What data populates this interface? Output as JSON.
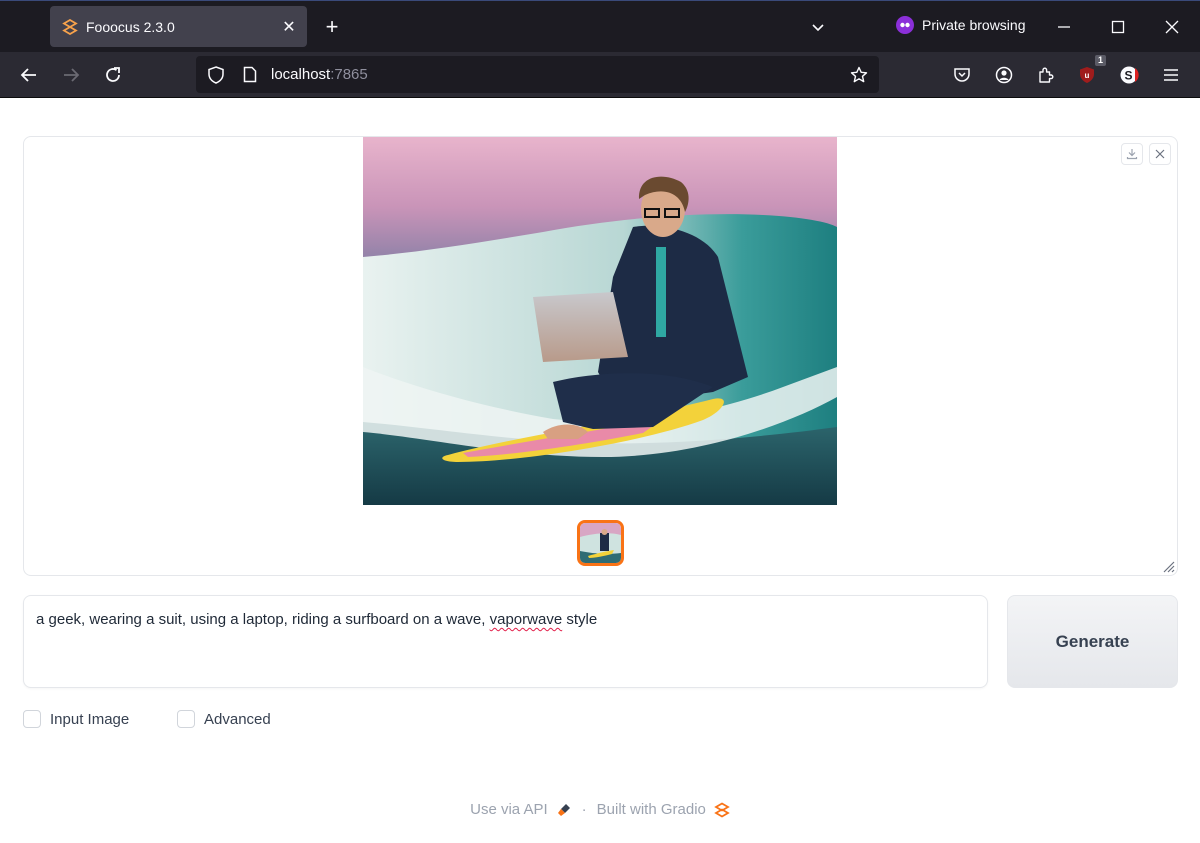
{
  "browser": {
    "tab": {
      "title": "Fooocus 2.3.0",
      "favicon": "gradio-logo-icon"
    },
    "private_label": "Private browsing",
    "url": {
      "host": "localhost",
      "port": ":7865"
    },
    "extension_badge": "1",
    "icons": {
      "back": "arrow-left-icon",
      "forward": "arrow-right-icon",
      "reload": "reload-icon",
      "shield": "tracking-protection-icon",
      "page": "page-icon",
      "bookmark": "star-icon",
      "pocket": "pocket-icon",
      "account": "account-icon",
      "extensions": "puzzle-icon",
      "ublock": "ublock-icon",
      "extension2": "s-extension-icon",
      "menu": "hamburger-menu-icon"
    }
  },
  "gallery": {
    "image_description": "A man in a suit with glasses using a laptop while riding a surfboard on a wave, vaporwave pink sky",
    "thumbnail_count": 1,
    "selected_thumbnail": 0
  },
  "prompt": {
    "before_misspelled": "a geek, wearing a suit, using a laptop, riding a surfboard on a wave, ",
    "misspelled": "vaporwave",
    "after_misspelled": " style"
  },
  "generate_label": "Generate",
  "checkboxes": [
    {
      "label": "Input Image",
      "checked": false
    },
    {
      "label": "Advanced",
      "checked": false
    }
  ],
  "footer": {
    "api_label": "Use via API",
    "separator": "·",
    "built_label": "Built with Gradio"
  },
  "colors": {
    "accent": "#f97316",
    "private_purple": "#8b2fd9"
  }
}
